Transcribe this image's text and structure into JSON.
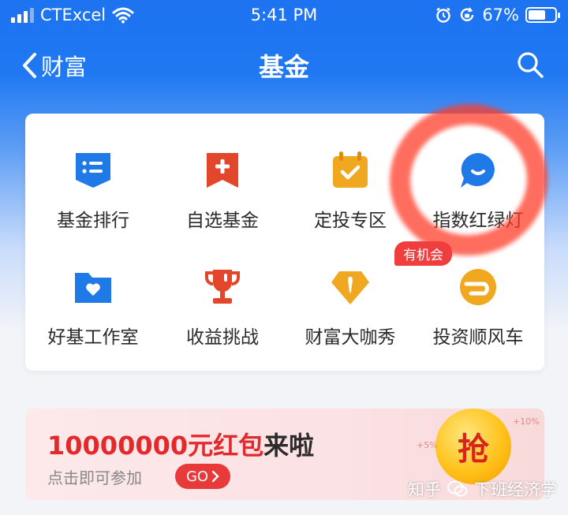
{
  "status_bar": {
    "carrier": "CTExcel",
    "time": "5:41 PM",
    "battery_percent": "67%",
    "battery_level": 0.67,
    "icons": [
      "signal-icon",
      "wifi-icon",
      "alarm-icon",
      "rotation-lock-icon",
      "battery-icon"
    ]
  },
  "nav": {
    "back_label": "财富",
    "title": "基金",
    "search_icon": "search-icon"
  },
  "grid": {
    "items": [
      {
        "label": "基金排行",
        "icon": "ranking-list-icon",
        "color": "#1f7ae8"
      },
      {
        "label": "自选基金",
        "icon": "bookmark-plus-icon",
        "color": "#e2472c"
      },
      {
        "label": "定投专区",
        "icon": "calendar-check-icon",
        "color": "#f0a820"
      },
      {
        "label": "指数红绿灯",
        "icon": "chat-smile-icon",
        "color": "#1f7ae8"
      },
      {
        "label": "好基工作室",
        "icon": "folder-heart-icon",
        "color": "#1f7ae8"
      },
      {
        "label": "收益挑战",
        "icon": "trophy-icon",
        "color": "#e2472c"
      },
      {
        "label": "财富大咖秀",
        "icon": "diamond-tie-icon",
        "color": "#f0a820"
      },
      {
        "label": "投资顺风车",
        "icon": "car-icon",
        "color": "#f0a820"
      }
    ],
    "badge": "有机会"
  },
  "banner": {
    "title_red": "10000000元红包",
    "title_dark": "来啦",
    "subtitle": "点击即可参加",
    "go_label": "GO",
    "coin_label": "抢",
    "pct_top": "+10%",
    "pct_left": "+5%"
  },
  "watermark": {
    "site": "知乎",
    "author": "下班经济学"
  },
  "colors": {
    "brand_blue": "#1f78f2",
    "highlight_red": "#ff3c28",
    "banner_red": "#e3292b"
  }
}
